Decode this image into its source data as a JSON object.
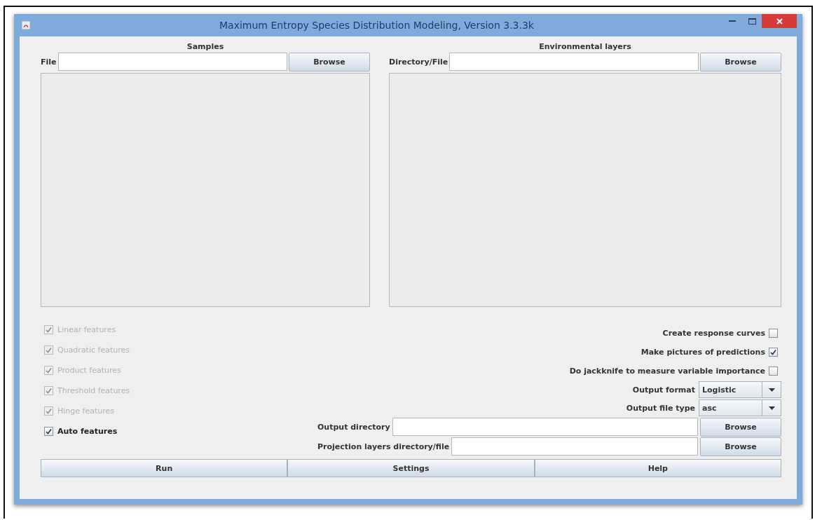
{
  "window": {
    "title": "Maximum Entropy Species Distribution Modeling, Version 3.3.3k"
  },
  "samples": {
    "heading": "Samples",
    "file_label": "File",
    "browse": "Browse"
  },
  "environmental_layers": {
    "heading": "Environmental layers",
    "file_label": "Directory/File",
    "browse": "Browse"
  },
  "features": [
    {
      "label": "Linear features",
      "checked": true,
      "disabled": true
    },
    {
      "label": "Quadratic features",
      "checked": true,
      "disabled": true
    },
    {
      "label": "Product features",
      "checked": true,
      "disabled": true
    },
    {
      "label": "Threshold features",
      "checked": true,
      "disabled": true
    },
    {
      "label": "Hinge features",
      "checked": true,
      "disabled": true
    },
    {
      "label": "Auto features",
      "checked": true,
      "disabled": false
    }
  ],
  "options": [
    {
      "label": "Create response curves",
      "checked": false
    },
    {
      "label": "Make pictures of predictions",
      "checked": true
    },
    {
      "label": "Do jackknife to measure variable importance",
      "checked": false
    }
  ],
  "dropdowns": [
    {
      "label": "Output format",
      "value": "Logistic"
    },
    {
      "label": "Output file type",
      "value": "asc"
    }
  ],
  "paths": [
    {
      "label": "Output directory",
      "browse": "Browse"
    },
    {
      "label": "Projection layers directory/file",
      "browse": "Browse"
    }
  ],
  "buttons": [
    "Run",
    "Settings",
    "Help"
  ]
}
